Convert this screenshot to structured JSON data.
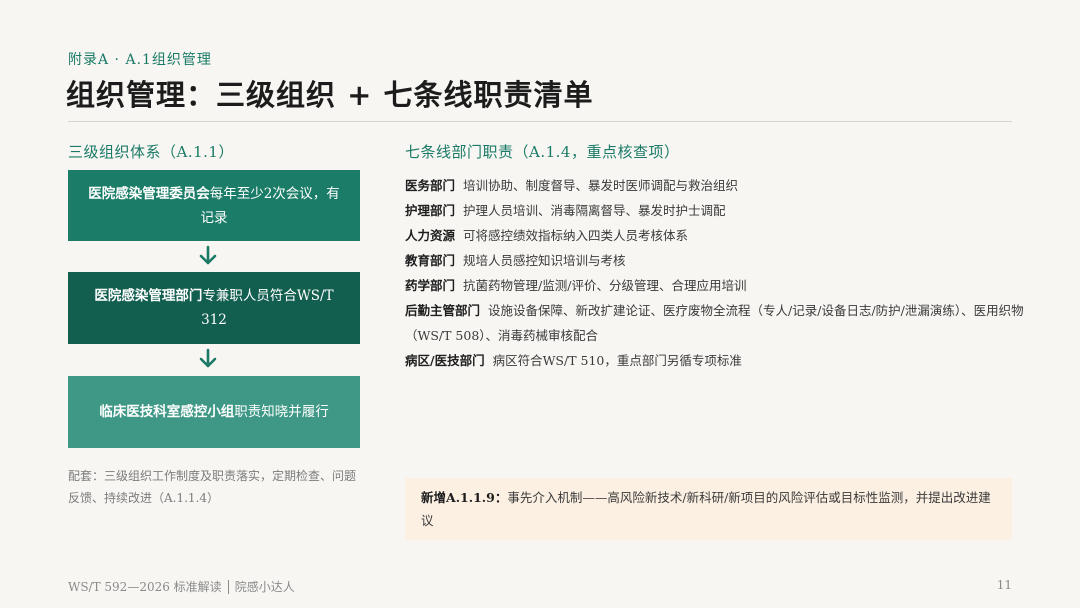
{
  "header": {
    "eyebrow": "附录A · A.1组织管理",
    "title": "组织管理：三级组织 + 七条线职责清单"
  },
  "left": {
    "heading": "三级组织体系（A.1.1）",
    "boxes": [
      {
        "strong": "医院感染管理委员会",
        "text": "每年至少2次会议，有记录"
      },
      {
        "strong": "医院感染管理部门",
        "text": "专兼职人员符合WS/T 312"
      },
      {
        "strong": "临床医技科室感控小组",
        "text": "职责知晓并履行"
      }
    ],
    "footnote": "配套：三级组织工作制度及职责落实，定期检查、问题反馈、持续改进（A.1.1.4）"
  },
  "right": {
    "heading": "七条线部门职责（A.1.4，重点核查项）",
    "duties": [
      {
        "dept": "医务部门",
        "text": "培训协助、制度督导、暴发时医师调配与救治组织"
      },
      {
        "dept": "护理部门",
        "text": "护理人员培训、消毒隔离督导、暴发时护士调配"
      },
      {
        "dept": "人力资源",
        "text": "可将感控绩效指标纳入四类人员考核体系"
      },
      {
        "dept": "教育部门",
        "text": "规培人员感控知识培训与考核"
      },
      {
        "dept": "药学部门",
        "text": "抗菌药物管理/监测/评价、分级管理、合理应用培训"
      },
      {
        "dept": "后勤主管部门",
        "text": "设施设备保障、新改扩建论证、医疗废物全流程（专人/记录/设备日志/防护/泄漏演练）、医用织物（WS/T 508）、消毒药械审核配合"
      },
      {
        "dept": "病区/医技部门",
        "text": "病区符合WS/T 510，重点部门另循专项标准"
      }
    ],
    "callout": {
      "strong": "新增A.1.1.9：",
      "text": "事先介入机制——高风险新技术/新科研/新项目的风险评估或目标性监测，并提出改进建议"
    }
  },
  "footer": {
    "doc": "WS/T 592—2026 标准解读",
    "author": "院感小达人",
    "page": "11"
  },
  "colors": {
    "accent": "#1a7a66",
    "box1": "#1b7d67",
    "box2": "#125f4f",
    "box3": "#3e9885",
    "callout_bg": "#fcf0e3"
  }
}
